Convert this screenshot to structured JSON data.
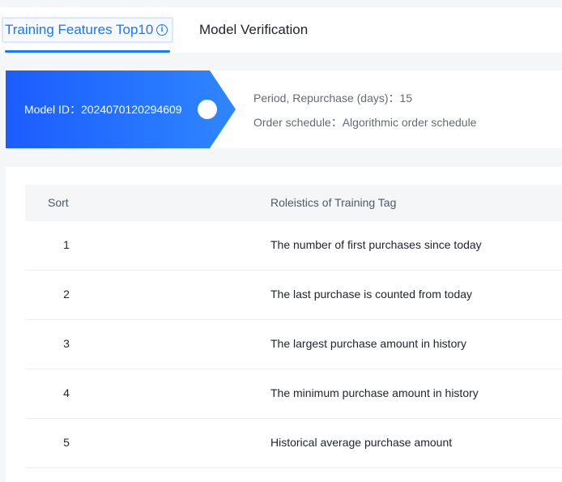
{
  "tabs": {
    "active_label": "Training Features Top10",
    "info_icon": "info-circle-icon",
    "second_label": "Model Verification"
  },
  "model": {
    "id_text": "Model ID：2024070120294609",
    "period_text": "Period, Repurchase (days)：15",
    "order_text": "Order schedule：Algorithmic order schedule"
  },
  "table": {
    "headers": [
      "Sort",
      "Roleistics of Training Tag"
    ],
    "rows": [
      {
        "sort": "1",
        "tag": "The number of first purchases since today"
      },
      {
        "sort": "2",
        "tag": "The last purchase is counted from today"
      },
      {
        "sort": "3",
        "tag": "The largest purchase amount in history"
      },
      {
        "sort": "4",
        "tag": "The minimum purchase amount in history"
      },
      {
        "sort": "5",
        "tag": "Historical average purchase amount"
      }
    ]
  },
  "colors": {
    "accent": "#1677ff",
    "badge_gradient_start": "#1b5cff",
    "badge_gradient_end": "#2f86ff"
  }
}
